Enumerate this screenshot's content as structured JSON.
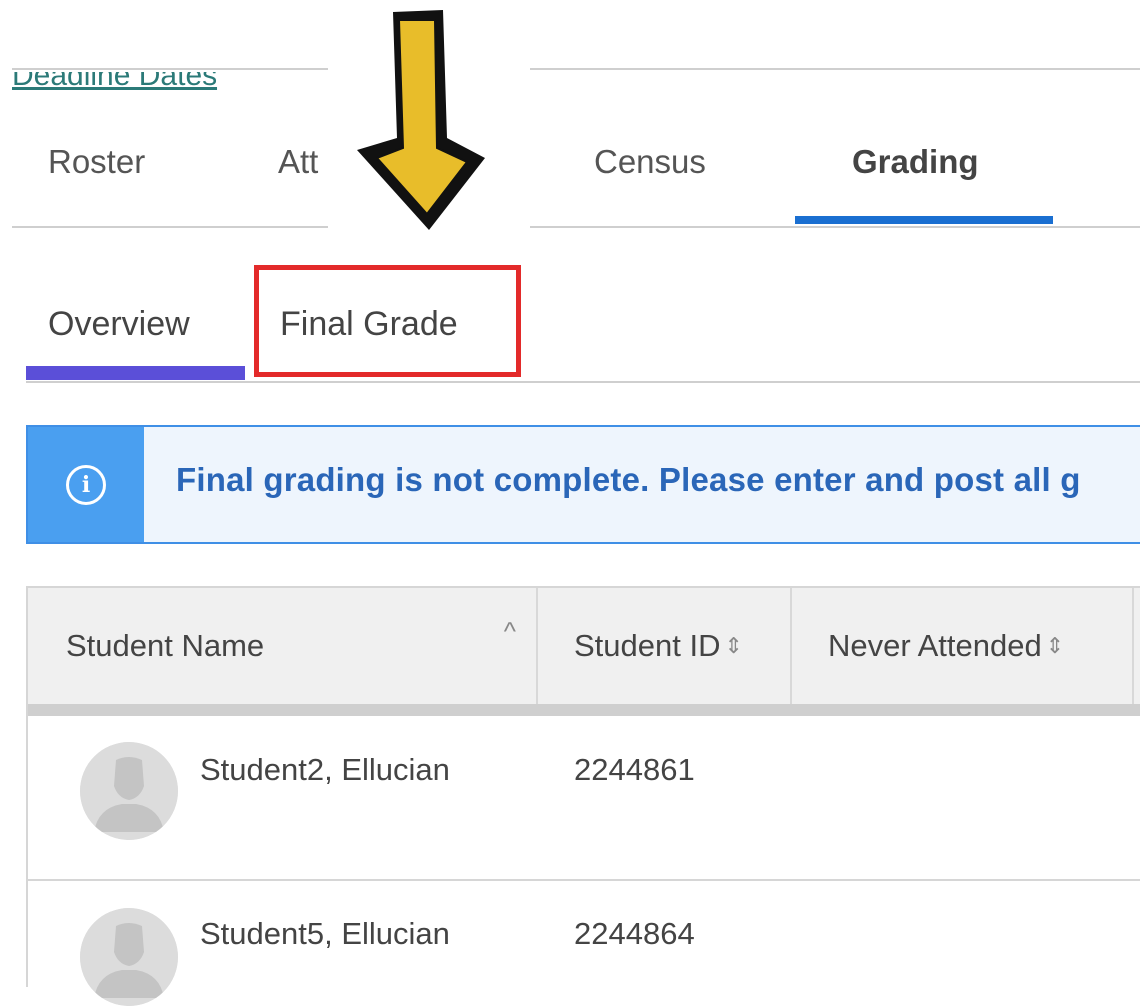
{
  "top_link": {
    "text": "Deadline Dates"
  },
  "main_tabs": [
    {
      "label": "Roster"
    },
    {
      "label": "Att"
    },
    {
      "label": "Census"
    },
    {
      "label": "Grading",
      "active": true
    }
  ],
  "sub_tabs": [
    {
      "label": "Overview",
      "active": true
    },
    {
      "label": "Final Grade",
      "highlighted": true
    }
  ],
  "banner": {
    "icon": "info-icon",
    "text": "Final grading is not complete. Please enter and post all g"
  },
  "table": {
    "columns": [
      {
        "label": "Student Name"
      },
      {
        "label": "Student ID"
      },
      {
        "label": "Never Attended"
      }
    ],
    "rows": [
      {
        "name": "Student2, Ellucian",
        "id": "2244861"
      },
      {
        "name": "Student5, Ellucian",
        "id": "2244864"
      }
    ]
  },
  "colors": {
    "active_tab_underline": "#1a6fd1",
    "sub_tab_underline": "#5b4fd8",
    "highlight_box": "#e32a2a",
    "banner_border": "#3f8fe6",
    "arrow_fill": "#e8bd2a"
  }
}
